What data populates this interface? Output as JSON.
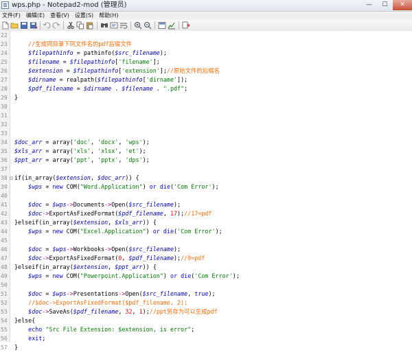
{
  "window": {
    "title": "wps.php - Notepad2-mod (管理员)",
    "controls": {
      "minimize": "—",
      "maximize": "☐",
      "close": "✕"
    }
  },
  "menu": [
    "文件(F)",
    "编辑(E)",
    "查看(V)",
    "设置(S)",
    "帮助(H)"
  ],
  "toolbar_icons": [
    "new-file-icon",
    "open-folder-icon",
    "save-icon",
    "save-as-icon",
    "undo-icon",
    "redo-icon",
    "cut-icon",
    "copy-icon",
    "paste-icon",
    "find-icon",
    "replace-icon",
    "word-wrap-icon",
    "zoom-in-icon",
    "zoom-out-icon",
    "scheme-icon",
    "settings-icon",
    "run-icon"
  ],
  "editor": {
    "lines": [
      {
        "n": "22",
        "code": ""
      },
      {
        "n": "23",
        "code": "    //生成同目录下同文件名的pdf后缀文件"
      },
      {
        "n": "24",
        "code": "    $filepathinfo = pathinfo($src_filename);"
      },
      {
        "n": "25",
        "code": "    $filename = $filepathinfo['filename'];"
      },
      {
        "n": "26",
        "code": "    $extension = $filepathinfo['extension'];//原始文件的后缀名"
      },
      {
        "n": "27",
        "code": "    $dirname = realpath($filepathinfo['dirname']);"
      },
      {
        "n": "28",
        "code": "    $pdf_filename = $dirname . $filename . \".pdf\";"
      },
      {
        "n": "29",
        "code": "}"
      },
      {
        "n": "30",
        "code": ""
      },
      {
        "n": "31",
        "code": ""
      },
      {
        "n": "32",
        "code": ""
      },
      {
        "n": "33",
        "code": ""
      },
      {
        "n": "34",
        "code": "$doc_arr = array('doc', 'docx', 'wps');"
      },
      {
        "n": "35",
        "code": "$xls_arr = array('xls', 'xlsx', 'et');"
      },
      {
        "n": "36",
        "code": "$ppt_arr = array('ppt', 'pptx', 'dps');"
      },
      {
        "n": "37",
        "code": ""
      },
      {
        "n": "38",
        "code": "if(in_array($extension, $doc_arr)) {"
      },
      {
        "n": "39",
        "code": "    $wps = new COM(\"Word.Application\") or die('Com Error');"
      },
      {
        "n": "40",
        "code": ""
      },
      {
        "n": "41",
        "code": "    $doc = $wps->Documents->Open($src_filename);"
      },
      {
        "n": "42",
        "code": "    $doc->ExportAsFixedFormat($pdf_filename, 17);//17=pdf"
      },
      {
        "n": "43",
        "code": "}elseif(in_array($extension, $xls_arr)) {"
      },
      {
        "n": "44",
        "code": "    $wps = new COM(\"Excel.Application\") or die('Com Error');"
      },
      {
        "n": "45",
        "code": ""
      },
      {
        "n": "46",
        "code": "    $doc = $wps->Workbooks->Open($src_filename);"
      },
      {
        "n": "47",
        "code": "    $doc->ExportAsFixedFormat(0, $pdf_filename);//0=pdf"
      },
      {
        "n": "48",
        "code": "}elseif(in_array($extension, $ppt_arr)) {"
      },
      {
        "n": "49",
        "code": "    $wps = new COM(\"Powerpoint.Application\") or die('Com Error');"
      },
      {
        "n": "50",
        "code": ""
      },
      {
        "n": "51",
        "code": "    $doc = $wps->Presentations->Open($src_filename, true);"
      },
      {
        "n": "52",
        "code": "    //$doc->ExportAsFixedFormat($pdf_filename, 2);"
      },
      {
        "n": "53",
        "code": "    $doc->SaveAs($pdf_filename, 32, 1);//ppt另存为可以生成pdf"
      },
      {
        "n": "54",
        "code": "}else{"
      },
      {
        "n": "55",
        "code": "    echo \"Src File Extension: $extension, is error\";"
      },
      {
        "n": "56",
        "code": "    exit;"
      },
      {
        "n": "57",
        "code": "}"
      }
    ]
  },
  "colors": {
    "variable": "#0000c0",
    "keyword": "#0000ff",
    "string": "#008000",
    "comment": "#ff6a00",
    "number": "#ff0000",
    "line_number": "#8c8c8c"
  }
}
